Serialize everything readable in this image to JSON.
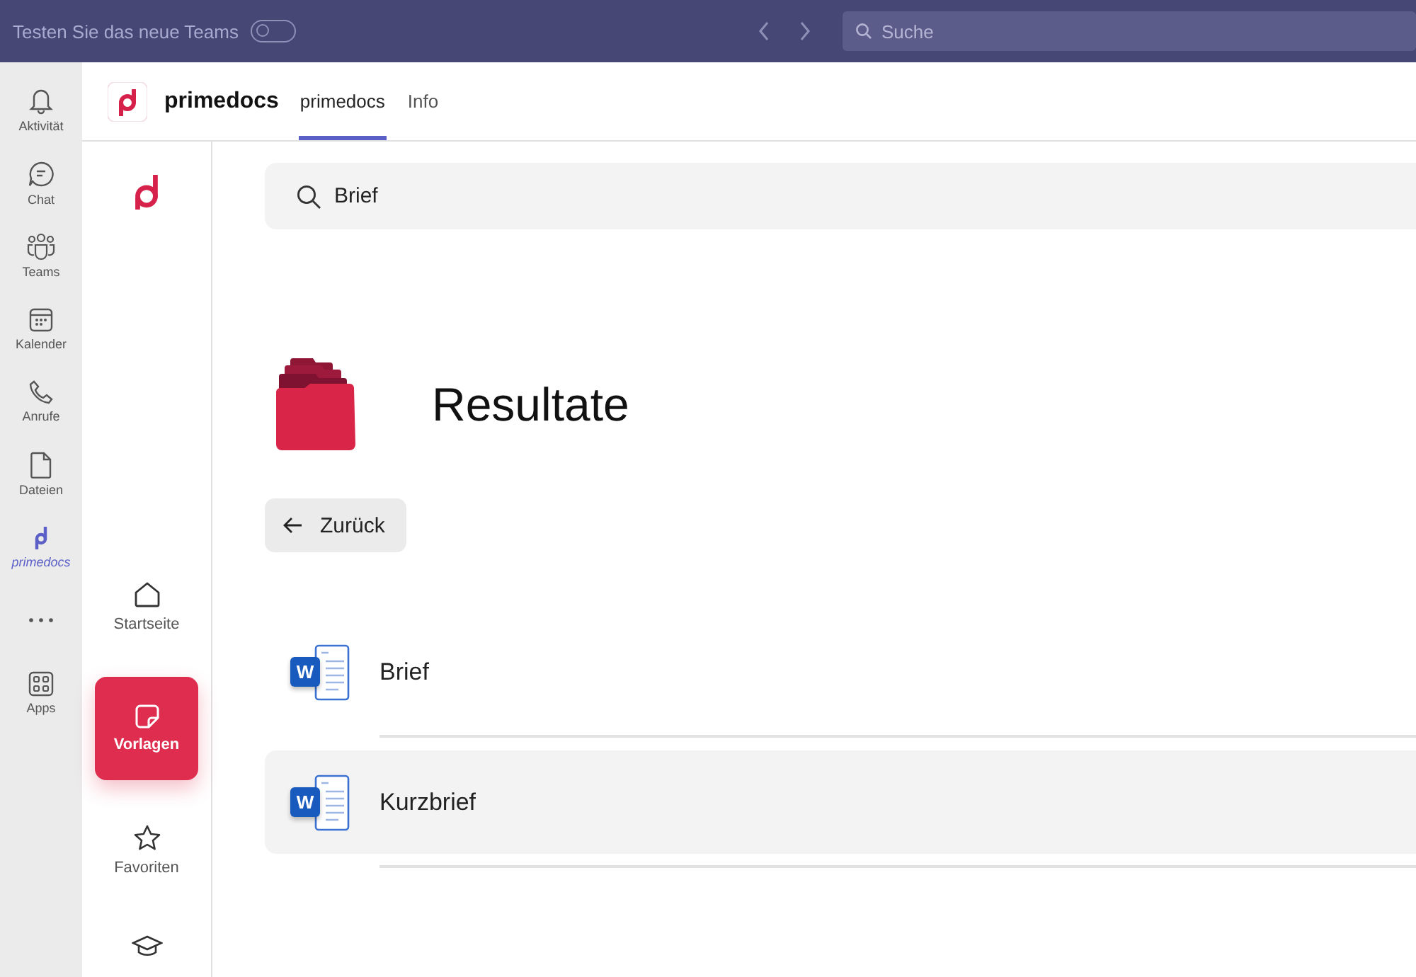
{
  "top_bar": {
    "new_teams_label": "Testen Sie das neue Teams",
    "new_teams_toggle_on": false,
    "search_placeholder": "Suche"
  },
  "rail": [
    {
      "kind": "bell",
      "label": "Aktivität",
      "selected": false
    },
    {
      "kind": "chat",
      "label": "Chat",
      "selected": false
    },
    {
      "kind": "teams",
      "label": "Teams",
      "selected": false
    },
    {
      "kind": "calendar",
      "label": "Kalender",
      "selected": false
    },
    {
      "kind": "phone",
      "label": "Anrufe",
      "selected": false
    },
    {
      "kind": "file",
      "label": "Dateien",
      "selected": false
    },
    {
      "kind": "app",
      "label": "primedocs",
      "selected": true
    },
    {
      "kind": "more",
      "selected": false
    },
    {
      "kind": "apps",
      "label": "Apps",
      "selected": false
    }
  ],
  "app_header": {
    "title": "primedocs",
    "tabs": [
      {
        "label": "primedocs",
        "selected": true
      },
      {
        "label": "Info",
        "selected": false
      }
    ]
  },
  "sidebar": [
    {
      "kind": "home",
      "label": "Startseite",
      "selected": false
    },
    {
      "kind": "templates",
      "label": "Vorlagen",
      "selected": true
    },
    {
      "kind": "star",
      "label": "Favoriten",
      "selected": false
    },
    {
      "kind": "cap",
      "selected": false
    }
  ],
  "search": {
    "value": "Brief"
  },
  "heading": "Resultate",
  "back_button": "Zurück",
  "results": [
    {
      "name": "Brief",
      "icon_letter": "W",
      "selected": false
    },
    {
      "name": "Kurzbrief",
      "icon_letter": "W",
      "selected": true
    }
  ]
}
